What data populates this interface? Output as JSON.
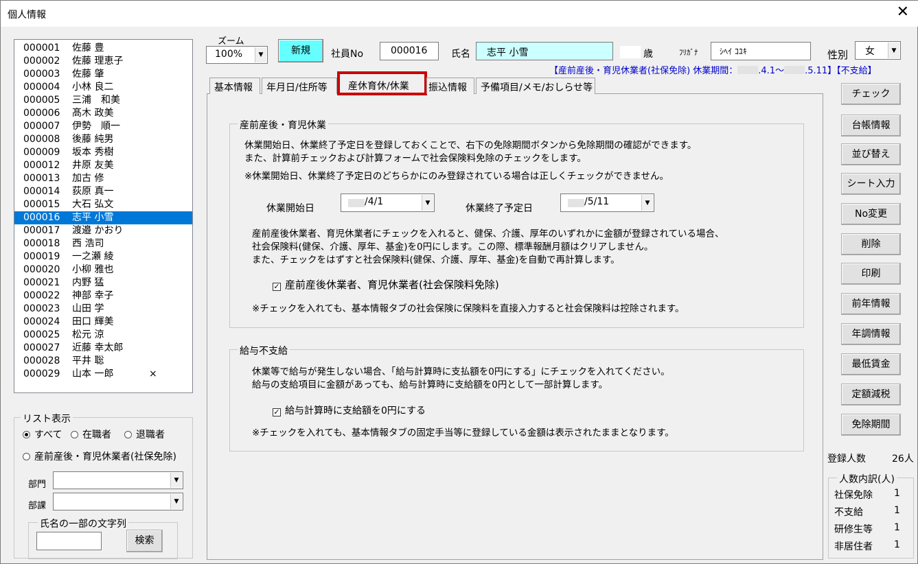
{
  "window": {
    "title": "個人情報",
    "close_glyph": "✕"
  },
  "employee_list": [
    {
      "no": "000001",
      "name": "佐藤 豊",
      "mark": ""
    },
    {
      "no": "000002",
      "name": "佐藤 理恵子",
      "mark": ""
    },
    {
      "no": "000003",
      "name": "佐藤 肇",
      "mark": ""
    },
    {
      "no": "000004",
      "name": "小林 良二",
      "mark": ""
    },
    {
      "no": "000005",
      "name": "三浦　和美",
      "mark": ""
    },
    {
      "no": "000006",
      "name": "髙木 政美",
      "mark": ""
    },
    {
      "no": "000007",
      "name": "伊勢　順一",
      "mark": ""
    },
    {
      "no": "000008",
      "name": "後藤 純男",
      "mark": ""
    },
    {
      "no": "000009",
      "name": "坂本 秀樹",
      "mark": ""
    },
    {
      "no": "000012",
      "name": "井原 友美",
      "mark": ""
    },
    {
      "no": "000013",
      "name": "加古 修",
      "mark": ""
    },
    {
      "no": "000014",
      "name": "荻原 真一",
      "mark": ""
    },
    {
      "no": "000015",
      "name": "大石 弘文",
      "mark": ""
    },
    {
      "no": "000016",
      "name": "志平 小雪",
      "mark": ""
    },
    {
      "no": "000017",
      "name": "渡邉 かおり",
      "mark": ""
    },
    {
      "no": "000018",
      "name": "西 浩司",
      "mark": ""
    },
    {
      "no": "000019",
      "name": "一之瀬 綾",
      "mark": ""
    },
    {
      "no": "000020",
      "name": "小柳 雅也",
      "mark": ""
    },
    {
      "no": "000021",
      "name": "内野 猛",
      "mark": ""
    },
    {
      "no": "000022",
      "name": "神部 幸子",
      "mark": ""
    },
    {
      "no": "000023",
      "name": "山田 学",
      "mark": ""
    },
    {
      "no": "000024",
      "name": "田口 輝美",
      "mark": ""
    },
    {
      "no": "000025",
      "name": "松元 涼",
      "mark": ""
    },
    {
      "no": "000027",
      "name": "近藤 幸太郎",
      "mark": ""
    },
    {
      "no": "000028",
      "name": "平井 聡",
      "mark": ""
    },
    {
      "no": "000029",
      "name": "山本 一郎",
      "mark": "×"
    }
  ],
  "selected_employee_no": "000016",
  "list_display": {
    "label": "リスト表示",
    "options": [
      "すべて",
      "在職者",
      "退職者"
    ],
    "option_leave": "産前産後・育児休業者(社保免除)",
    "selected": "すべて",
    "dept_label": "部門",
    "section_label": "部課",
    "dept_value": "",
    "section_value": "",
    "name_search": {
      "label": "氏名の一部の文字列",
      "value": "",
      "button": "検索"
    }
  },
  "header": {
    "zoom_label": "ズーム",
    "zoom_value": "100%",
    "new_button": "新規",
    "emp_no_label": "社員No",
    "emp_no_value": "000016",
    "name_label": "氏名",
    "name_value": "志平 小雪",
    "age_value": "",
    "age_label": "歳",
    "furigana_label": "ﾌﾘｶﾞﾅ",
    "furigana_value": "ｼﾍｲ ｺﾕｷ",
    "gender_label": "性別",
    "gender_value": "女",
    "status_text": "【産前産後・育児休業者(社保免除) 休業期間：",
    "status_period_start": ".4.1～",
    "status_period_end": ".5.11】【不支給】"
  },
  "tabs": [
    "基本情報",
    "年月日/住所等",
    "産休育休/休業",
    "振込情報",
    "予備項目/メモ/おしらせ等"
  ],
  "active_tab": "産休育休/休業",
  "leave_section": {
    "title": "産前産後・育児休業",
    "desc1": "休業開始日、休業終了予定日を登録しておくことで、右下の免除期間ボタンから免除期間の確認ができます。",
    "desc2": "また、計算前チェックおよび計算フォームで社会保険料免除のチェックをします。",
    "note1": "※休業開始日、休業終了予定日のどちらかにのみ登録されている場合は正しくチェックができません。",
    "start_label": "休業開始日",
    "start_value": "/4/1",
    "end_label": "休業終了予定日",
    "end_value": "/5/11",
    "desc3": "産前産後休業者、育児休業者にチェックを入れると、健保、介護、厚年のいずれかに金額が登録されている場合、",
    "desc4": "社会保険料(健保、介護、厚年、基金)を0円にします。この際、標準報酬月額はクリアしません。",
    "desc5": "また、チェックをはずすと社会保険料(健保、介護、厚年、基金)を自動で再計算します。",
    "checkbox_label": "産前産後休業者、育児休業者(社会保険料免除)",
    "checkbox_checked": true,
    "note2": "※チェックを入れても、基本情報タブの社会保険に保険料を直接入力すると社会保険料は控除されます。"
  },
  "nopay_section": {
    "title": "給与不支給",
    "desc1": "休業等で給与が発生しない場合、「給与計算時に支払額を0円にする」にチェックを入れてください。",
    "desc2": "給与の支給項目に金額があっても、給与計算時に支給額を0円として一部計算します。",
    "checkbox_label": "給与計算時に支給額を0円にする",
    "checkbox_checked": true,
    "note": "※チェックを入れても、基本情報タブの固定手当等に登録している金額は表示されたままとなります。"
  },
  "side_buttons": [
    "チェック",
    "台帳情報",
    "並び替え",
    "シート入力",
    "No変更",
    "削除",
    "印刷",
    "前年情報",
    "年調情報",
    "最低賃金",
    "定額減税",
    "免除期間"
  ],
  "registered": {
    "label": "登録人数",
    "value": "26人"
  },
  "breakdown": {
    "title": "人数内訳(人)",
    "rows": [
      {
        "label": "社保免除",
        "value": "1"
      },
      {
        "label": "不支給",
        "value": "1"
      },
      {
        "label": "研修生等",
        "value": "1"
      },
      {
        "label": "非居住者",
        "value": "1"
      }
    ]
  },
  "colors": {
    "selection": "#0078d7",
    "highlight_input": "#ccffff",
    "new_button": "#66ffff",
    "active_tab_border": "#cc0000",
    "status_text": "#0000cc"
  }
}
